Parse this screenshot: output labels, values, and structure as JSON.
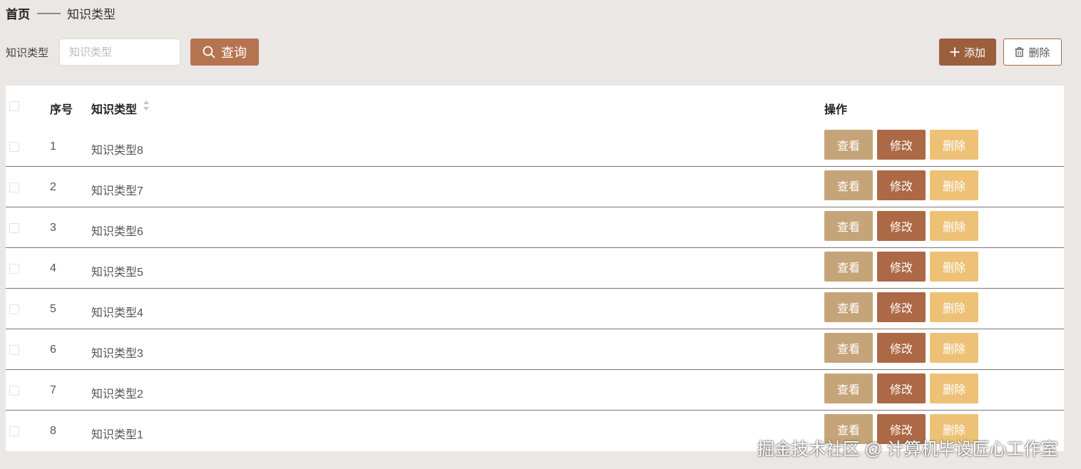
{
  "breadcrumb": {
    "home": "首页",
    "separator": "——",
    "current": "知识类型"
  },
  "search": {
    "label": "知识类型",
    "placeholder": "知识类型",
    "value": "",
    "button_label": "查询"
  },
  "actions": {
    "add_label": "添加",
    "delete_label": "删除"
  },
  "table": {
    "headers": {
      "index": "序号",
      "name": "知识类型",
      "ops": "操作"
    },
    "rows": [
      {
        "index": "1",
        "name": "知识类型8"
      },
      {
        "index": "2",
        "name": "知识类型7"
      },
      {
        "index": "3",
        "name": "知识类型6"
      },
      {
        "index": "4",
        "name": "知识类型5"
      },
      {
        "index": "5",
        "name": "知识类型4"
      },
      {
        "index": "6",
        "name": "知识类型3"
      },
      {
        "index": "7",
        "name": "知识类型2"
      },
      {
        "index": "8",
        "name": "知识类型1"
      }
    ],
    "row_actions": {
      "view": "查看",
      "edit": "修改",
      "delete": "删除"
    }
  },
  "watermark": "掘金技术社区 @ 计算机毕设匠心工作室",
  "colors": {
    "page_bg": "#ebe7e5",
    "primary": "#b57350",
    "add_button": "#9c5f3d",
    "view_button": "#c6a479",
    "edit_button": "#ad6945",
    "delete_button": "#edc276"
  },
  "icons": {
    "query": "search-icon",
    "add": "plus-icon",
    "delete": "trash-icon",
    "sort": "sort-icon"
  }
}
